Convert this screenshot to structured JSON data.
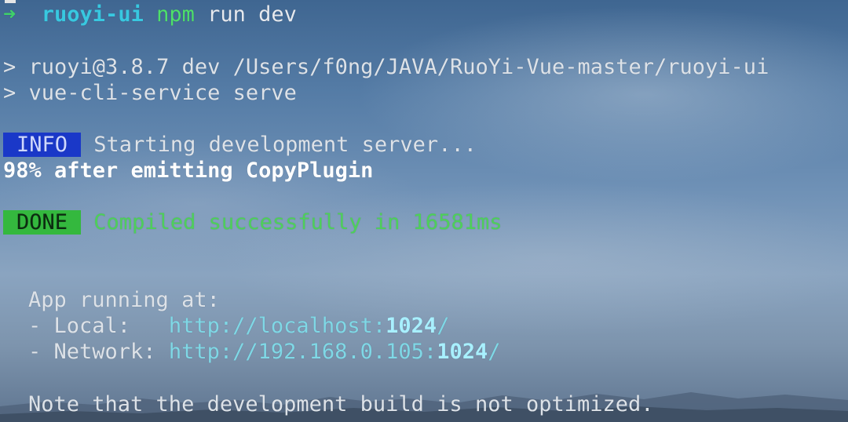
{
  "prompt": {
    "arrow": "➜",
    "directory": "ruoyi-ui",
    "command": "npm",
    "args": "run dev"
  },
  "npm_output": [
    "> ruoyi@3.8.7 dev /Users/f0ng/JAVA/RuoYi-Vue-master/ruoyi-ui",
    "> vue-cli-service serve"
  ],
  "info": {
    "badge": "INFO",
    "message": "Starting development server..."
  },
  "progress": "98% after emitting CopyPlugin",
  "done": {
    "badge": "DONE",
    "message": "Compiled successfully in 16581ms"
  },
  "app_running": {
    "heading": "App running at:",
    "local": {
      "label": "- Local:   ",
      "url_prefix": "http://localhost:",
      "port": "1024",
      "url_suffix": "/"
    },
    "network": {
      "label": "- Network: ",
      "url_prefix": "http://192.168.0.105:",
      "port": "1024",
      "url_suffix": "/"
    }
  },
  "note": "Note that the development build is not optimized.",
  "colors": {
    "info_badge": "#1a38c8",
    "done_badge": "#34b83e",
    "success_text": "#4ed05a",
    "url_text": "#7fd8e6"
  }
}
